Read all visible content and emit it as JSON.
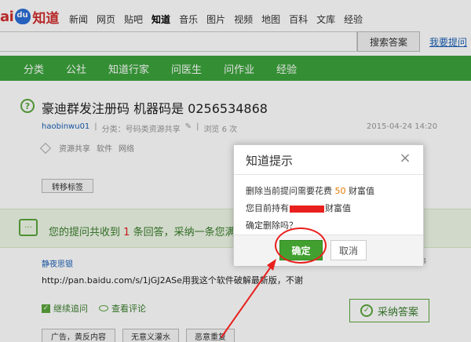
{
  "logo": {
    "brand_left": "ai",
    "brand_right": "知道"
  },
  "topnav": {
    "items": [
      "新闻",
      "网页",
      "贴吧",
      "知道",
      "音乐",
      "图片",
      "视频",
      "地图",
      "百科",
      "文库",
      "经验"
    ],
    "active": "知道"
  },
  "search": {
    "input_value": "",
    "button_label": "搜索答案",
    "ask_link": "我要提问"
  },
  "greennav": {
    "items": [
      "分类",
      "公社",
      "知道行家",
      "问医生",
      "问作业",
      "经验"
    ]
  },
  "question": {
    "icon_glyph": "?",
    "title": "豪迪群发注册码 机器码是 0256534868",
    "user": "haobinwu01",
    "category": "分类：号码类资源共享",
    "views": "浏览 6 次",
    "date": "2015-04-24 14:20",
    "tags": [
      "资源共享",
      "软件",
      "网络"
    ],
    "transfer_label": "转移标签"
  },
  "notice": {
    "prefix": "您的提问共收到",
    "count": "1",
    "suffix": "条回答，采纳一条您满"
  },
  "answer": {
    "user": "静夜思银",
    "side_num": "4",
    "text": "http://pan.baidu.com/s/1jGJ2ASe用我这个软件破解最新版，不谢",
    "followup_label": "继续追问",
    "comments_label": "查看评论",
    "adopt_label": "采纳答案",
    "reports": [
      "广告，黄反内容",
      "无意义灌水",
      "恶意重复"
    ]
  },
  "dialog": {
    "title": "知道提示",
    "close_glyph": "×",
    "line1_prefix": "删除当前提问需要花费",
    "line1_num": "50",
    "line1_suffix": "财富值",
    "line2_prefix": "您目前持有",
    "line2_suffix": "财富值",
    "line3": "确定删除吗？",
    "confirm_label": "确定",
    "cancel_label": "取消"
  },
  "colors": {
    "green": "#3ca33c",
    "annotation_red": "#e8201e",
    "link_blue": "#1a5fb4",
    "number_orange": "#e87a00"
  }
}
